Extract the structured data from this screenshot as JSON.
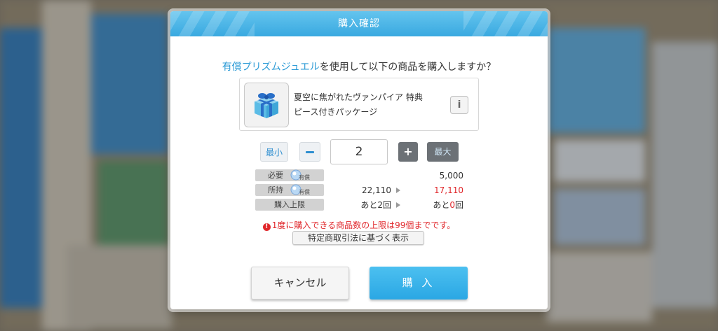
{
  "dialog": {
    "title": "購入確認",
    "question_highlight": "有償プリズムジュエル",
    "question_rest": "を使用して以下の商品を購入しますか？"
  },
  "product": {
    "name_line1": "夏空に焦がれたヴァンパイア 特典",
    "name_line2": "ピース付きパッケージ",
    "thumbnail_icon": "gift-box-icon",
    "info_label": "i"
  },
  "quantity": {
    "min_label": "最小",
    "value": "2",
    "max_label": "最大",
    "plus_label": "+"
  },
  "info": {
    "required_label": "必要",
    "required_value": "5,000",
    "owned_label": "所持",
    "owned_current": "22,110",
    "owned_after": "17,110",
    "limit_label": "購入上限",
    "limit_current": "あと2回",
    "limit_after_prefix": "あと",
    "limit_after_number": "0",
    "limit_after_suffix": "回",
    "currency_tag": "有償"
  },
  "warning": {
    "icon": "!",
    "text": "1度に購入できる商品数の上限は99個までです。"
  },
  "buttons": {
    "law": "特定商取引法に基づく表示",
    "cancel": "キャンセル",
    "buy": "購 入"
  },
  "colors": {
    "accent": "#39a9e0",
    "highlight": "#2d9bd6",
    "warning": "#e0262a"
  }
}
